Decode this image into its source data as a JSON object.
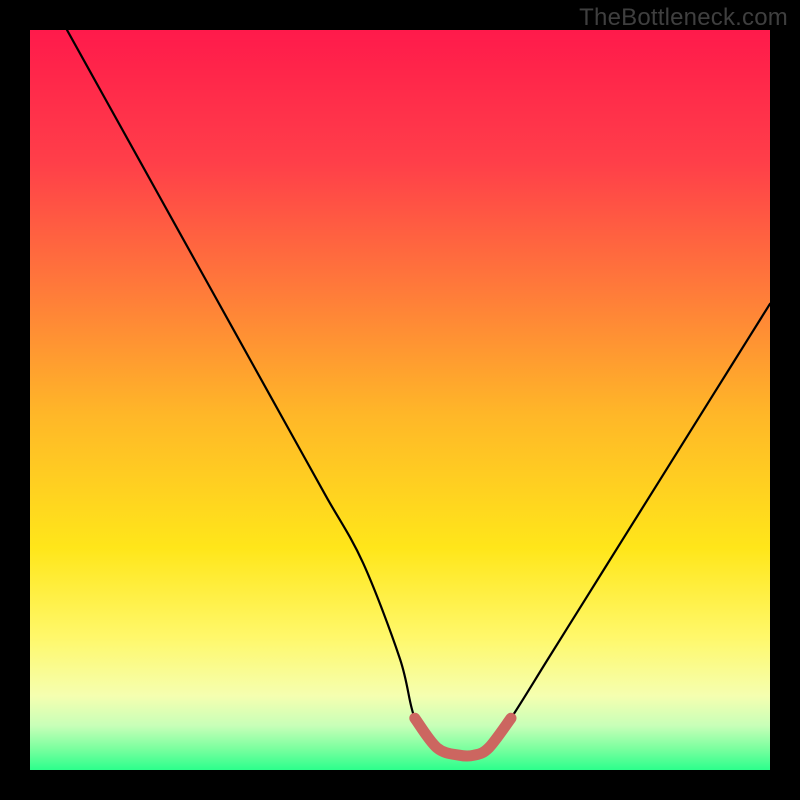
{
  "watermark": "TheBottleneck.com",
  "chart_data": {
    "type": "line",
    "title": "",
    "xlabel": "",
    "ylabel": "",
    "xlim": [
      0,
      100
    ],
    "ylim": [
      0,
      100
    ],
    "series": [
      {
        "name": "bottleneck-curve",
        "x": [
          5,
          10,
          15,
          20,
          25,
          30,
          35,
          40,
          45,
          50,
          52,
          55,
          58,
          60,
          62,
          65,
          70,
          75,
          80,
          85,
          90,
          95,
          100
        ],
        "y": [
          100,
          91,
          82,
          73,
          64,
          55,
          46,
          37,
          28,
          15,
          7,
          3,
          2,
          2,
          3,
          7,
          15,
          23,
          31,
          39,
          47,
          55,
          63
        ]
      },
      {
        "name": "highlight-band",
        "x": [
          52,
          55,
          58,
          60,
          62,
          65
        ],
        "y": [
          7,
          3,
          2,
          2,
          3,
          7
        ]
      }
    ],
    "gradient_stops": [
      {
        "pos": 0.0,
        "color": "#ff1a4b"
      },
      {
        "pos": 0.18,
        "color": "#ff3f49"
      },
      {
        "pos": 0.35,
        "color": "#ff7a3a"
      },
      {
        "pos": 0.52,
        "color": "#ffb728"
      },
      {
        "pos": 0.7,
        "color": "#ffe61a"
      },
      {
        "pos": 0.82,
        "color": "#fff86a"
      },
      {
        "pos": 0.9,
        "color": "#f5ffb0"
      },
      {
        "pos": 0.94,
        "color": "#c8ffb8"
      },
      {
        "pos": 0.97,
        "color": "#7effa0"
      },
      {
        "pos": 1.0,
        "color": "#2cff8c"
      }
    ],
    "highlight_color": "#cc6660"
  }
}
